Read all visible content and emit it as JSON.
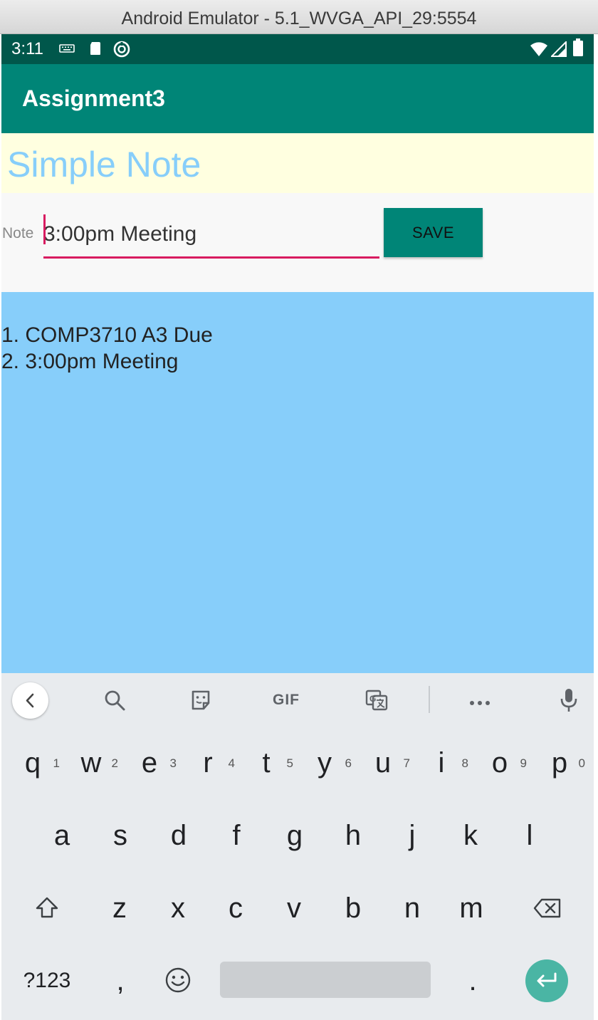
{
  "window": {
    "title": "Android Emulator - 5.1_WVGA_API_29:5554"
  },
  "status_bar": {
    "time": "3:11"
  },
  "app_bar": {
    "title": "Assignment3"
  },
  "header": {
    "title": "Simple Note"
  },
  "input_row": {
    "label": "Note",
    "value": "3:00pm Meeting",
    "save_label": "SAVE"
  },
  "notes": [
    "1. COMP3710  A3 Due",
    "2. 3:00pm Meeting"
  ],
  "keyboard": {
    "toolbar": {
      "gif_label": "GIF"
    },
    "row1": [
      {
        "key": "q",
        "hint": "1"
      },
      {
        "key": "w",
        "hint": "2"
      },
      {
        "key": "e",
        "hint": "3"
      },
      {
        "key": "r",
        "hint": "4"
      },
      {
        "key": "t",
        "hint": "5"
      },
      {
        "key": "y",
        "hint": "6"
      },
      {
        "key": "u",
        "hint": "7"
      },
      {
        "key": "i",
        "hint": "8"
      },
      {
        "key": "o",
        "hint": "9"
      },
      {
        "key": "p",
        "hint": "0"
      }
    ],
    "row2": [
      "a",
      "s",
      "d",
      "f",
      "g",
      "h",
      "j",
      "k",
      "l"
    ],
    "row3": [
      "z",
      "x",
      "c",
      "v",
      "b",
      "n",
      "m"
    ],
    "symbols_label": "?123",
    "comma": ",",
    "period": "."
  },
  "colors": {
    "status_bar": "#00574b",
    "app_bar": "#008577",
    "header_bg": "#ffffe0",
    "header_text": "#87cefa",
    "notes_bg": "#87cefa",
    "accent": "#d81b60",
    "enter_key": "#4ab5a4"
  }
}
